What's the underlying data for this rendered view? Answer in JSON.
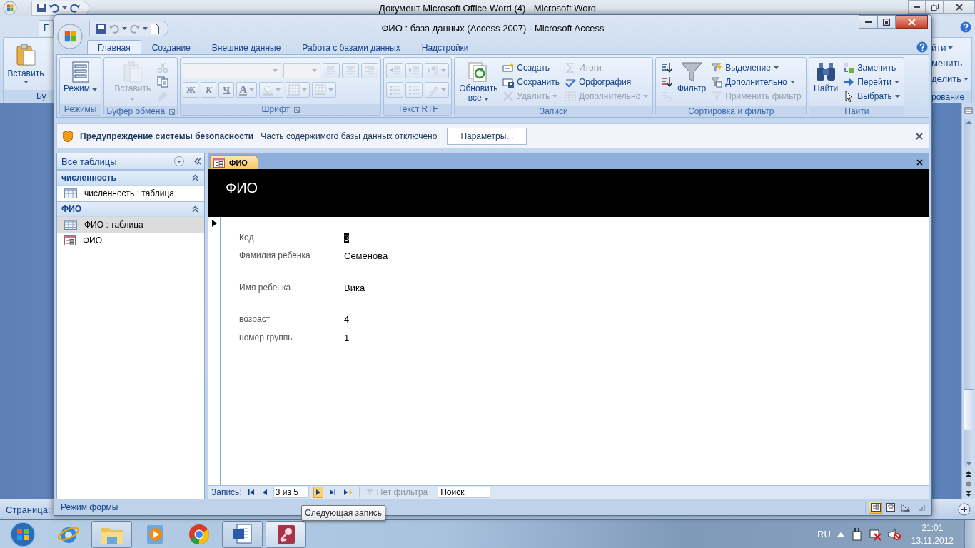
{
  "word_window": {
    "title": "Документ Microsoft Office Word (4) - Microsoft Word",
    "tab_fragment": "Г",
    "paste_label": "Вставить",
    "group_fragment": "Бу",
    "right_fragments": [
      {
        "text": "йти",
        "dropdown": true
      },
      {
        "text": "менить",
        "dropdown": false
      },
      {
        "text": "делить",
        "dropdown": true
      },
      {
        "text": "рование",
        "dropdown": false
      }
    ],
    "status_fragment": "Страница:"
  },
  "access_window": {
    "title": "ФИО : база данных (Access 2007) - Microsoft Access",
    "tabs": [
      {
        "label": "Главная",
        "selected": true
      },
      {
        "label": "Создание",
        "selected": false
      },
      {
        "label": "Внешние данные",
        "selected": false
      },
      {
        "label": "Работа с базами данных",
        "selected": false
      },
      {
        "label": "Надстройки",
        "selected": false
      }
    ],
    "ribbon_groups": [
      {
        "label": "Режимы",
        "launcher": false,
        "items": [
          {
            "kind": "large",
            "label": "Режим",
            "disabled": false,
            "dropdown": true
          }
        ]
      },
      {
        "label": "Буфер обмена",
        "launcher": true,
        "items": [
          {
            "kind": "large",
            "label": "Вставить",
            "disabled": true,
            "dropdown": true
          },
          {
            "kind": "small",
            "disabled": true,
            "dropdown": false
          },
          {
            "kind": "small",
            "disabled": false,
            "dropdown": false
          },
          {
            "kind": "small",
            "disabled": true,
            "dropdown": false
          }
        ]
      },
      {
        "label": "Шрифт",
        "launcher": true,
        "items": [
          {
            "kind": "combo",
            "disabled": true,
            "dropdown": true
          },
          {
            "kind": "combo",
            "disabled": true,
            "dropdown": true
          },
          {
            "kind": "tool",
            "disabled": true,
            "dropdown": false
          },
          {
            "kind": "tool",
            "disabled": true,
            "dropdown": false
          },
          {
            "kind": "tool",
            "disabled": true,
            "dropdown": false
          },
          {
            "kind": "tool",
            "glyph": "Ж",
            "disabled": true,
            "dropdown": false
          },
          {
            "kind": "tool",
            "glyph": "К",
            "disabled": true,
            "dropdown": false
          },
          {
            "kind": "tool",
            "glyph": "Ч",
            "disabled": true,
            "dropdown": false
          },
          {
            "kind": "tool",
            "glyph": "A",
            "disabled": true,
            "dropdown": true
          },
          {
            "kind": "tool",
            "disabled": true,
            "dropdown": true
          },
          {
            "kind": "tool",
            "disabled": true,
            "dropdown": true
          },
          {
            "kind": "tool",
            "disabled": true,
            "dropdown": true
          }
        ]
      },
      {
        "label": "Текст RTF",
        "launcher": false,
        "items": [
          {
            "kind": "tool",
            "disabled": true,
            "dropdown": false
          },
          {
            "kind": "tool",
            "disabled": true,
            "dropdown": false
          },
          {
            "kind": "tool",
            "disabled": true,
            "dropdown": true
          },
          {
            "kind": "tool",
            "disabled": true,
            "dropdown": false
          },
          {
            "kind": "tool",
            "disabled": true,
            "dropdown": false
          },
          {
            "kind": "tool",
            "disabled": true,
            "dropdown": true
          }
        ]
      },
      {
        "label": "Записи",
        "launcher": false,
        "items": [
          {
            "kind": "large",
            "label": "Обновить все",
            "disabled": false,
            "dropdown": true
          },
          {
            "kind": "small",
            "label": "Создать",
            "disabled": false,
            "dropdown": false
          },
          {
            "kind": "small",
            "label": "Сохранить",
            "disabled": false,
            "dropdown": false
          },
          {
            "kind": "small",
            "label": "Удалить",
            "disabled": true,
            "dropdown": true
          },
          {
            "kind": "small",
            "label": "Итоги",
            "disabled": true,
            "dropdown": false
          },
          {
            "kind": "small",
            "label": "Орфография",
            "disabled": false,
            "dropdown": false
          },
          {
            "kind": "small",
            "label": "Дополнительно",
            "disabled": true,
            "dropdown": true
          }
        ]
      },
      {
        "label": "Сортировка и фильтр",
        "launcher": false,
        "items": [
          {
            "kind": "small",
            "disabled": false,
            "dropdown": false
          },
          {
            "kind": "small",
            "disabled": false,
            "dropdown": false
          },
          {
            "kind": "small",
            "disabled": true,
            "dropdown": false
          },
          {
            "kind": "large",
            "label": "Фильтр",
            "disabled": false,
            "dropdown": false
          },
          {
            "kind": "small",
            "label": "Выделение",
            "disabled": false,
            "dropdown": true
          },
          {
            "kind": "small",
            "label": "Дополнительно",
            "disabled": false,
            "dropdown": true
          },
          {
            "kind": "small",
            "label": "Применить фильтр",
            "disabled": true,
            "dropdown": false
          }
        ]
      },
      {
        "label": "Найти",
        "launcher": false,
        "items": [
          {
            "kind": "large",
            "label": "Найти",
            "disabled": false,
            "dropdown": false
          },
          {
            "kind": "small",
            "label": "Заменить",
            "disabled": false,
            "dropdown": false
          },
          {
            "kind": "small",
            "label": "Перейти",
            "disabled": false,
            "dropdown": true
          },
          {
            "kind": "small",
            "label": "Выбрать",
            "disabled": false,
            "dropdown": true
          }
        ]
      }
    ],
    "security_bar": {
      "title": "Предупреждение системы безопасности",
      "message": "Часть содержимого базы данных отключено",
      "button": "Параметры..."
    },
    "nav_pane": {
      "header": "Все таблицы",
      "groups": [
        {
          "label": "численность",
          "expanded": true,
          "items": [
            {
              "label": "численность : таблица",
              "kind": "table",
              "selected": false
            }
          ]
        },
        {
          "label": "ФИО",
          "expanded": true,
          "items": [
            {
              "label": "ФИО : таблица",
              "kind": "table",
              "selected": true
            },
            {
              "label": "ФИО",
              "kind": "form",
              "selected": false
            }
          ]
        }
      ]
    },
    "document": {
      "tab": {
        "label": "ФИО",
        "selected": true
      },
      "form_title": "ФИО",
      "fields": [
        {
          "label": "Код",
          "value": "3",
          "selected": true
        },
        {
          "label": "Фамилия ребенка",
          "value": "Семенова",
          "selected": false
        },
        {
          "label": "Имя ребенка",
          "value": "Вика",
          "selected": false
        },
        {
          "label": "возраст",
          "value": "4",
          "selected": false
        },
        {
          "label": "номер группы",
          "value": "1",
          "selected": false
        }
      ],
      "record_nav": {
        "label": "Запись:",
        "position": "3 из 5",
        "buttons": [
          {
            "kind": "first",
            "hovered": false
          },
          {
            "kind": "prev",
            "hovered": false
          },
          {
            "kind": "next",
            "hovered": true
          },
          {
            "kind": "last",
            "hovered": false
          },
          {
            "kind": "new",
            "hovered": false
          }
        ],
        "filter": "Нет фильтра",
        "search_placeholder": "Поиск",
        "tooltip": "Следующая запись"
      }
    },
    "status_bar": {
      "text": "Режим формы",
      "views": [
        {
          "kind": "form",
          "selected": true
        },
        {
          "kind": "layout",
          "selected": false
        },
        {
          "kind": "design",
          "selected": false
        }
      ]
    }
  },
  "taskbar": {
    "apps": [
      {
        "kind": "ie",
        "running": false,
        "active": false
      },
      {
        "kind": "explorer",
        "running": true,
        "active": false
      },
      {
        "kind": "media",
        "running": false,
        "active": false
      },
      {
        "kind": "chrome",
        "running": false,
        "active": false
      },
      {
        "kind": "word",
        "running": true,
        "active": false
      },
      {
        "kind": "access",
        "running": true,
        "active": true
      }
    ],
    "tray": {
      "language": "RU",
      "time": "21:01",
      "date": "13.11.2012"
    }
  }
}
